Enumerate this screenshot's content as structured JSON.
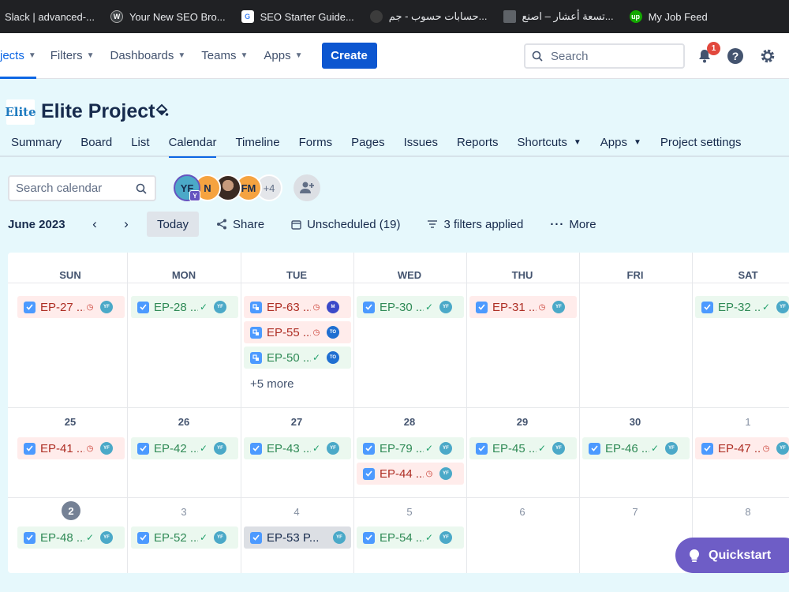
{
  "bookmarks": [
    {
      "label": "Slack | advanced-...",
      "icon": "slack-icon",
      "color": "#202124"
    },
    {
      "label": "Your New SEO Bro...",
      "icon": "wordpress-icon",
      "color": "#21759b"
    },
    {
      "label": "SEO Starter Guide...",
      "icon": "google-icon",
      "color": "#ffffff"
    },
    {
      "label": "حسابات حسوب - جم...",
      "icon": "hsoub-icon",
      "color": "#3c3c3c"
    },
    {
      "label": "تسعة أعشار – اصنع...",
      "icon": "site-icon",
      "color": "#5f6368"
    },
    {
      "label": "My Job Feed",
      "icon": "upwork-icon",
      "color": "#14a800"
    }
  ],
  "topnav": {
    "items": [
      "jects",
      "Filters",
      "Dashboards",
      "Teams",
      "Apps"
    ],
    "create_label": "Create",
    "search_placeholder": "Search",
    "notification_count": "1"
  },
  "project": {
    "logo_text": "Elite",
    "title": "Elite Project",
    "tabs": [
      "Summary",
      "Board",
      "List",
      "Calendar",
      "Timeline",
      "Forms",
      "Pages",
      "Issues",
      "Reports",
      "Shortcuts",
      "Apps",
      "Project settings"
    ],
    "active_tab": "Calendar"
  },
  "toolbar": {
    "search_placeholder": "Search calendar",
    "avatars": [
      {
        "initials": "YF",
        "color": "#4ba9c8",
        "sub": "Y"
      },
      {
        "initials": "N",
        "color": "#f5a340"
      },
      {
        "initials": "",
        "color": "#3b2a22"
      },
      {
        "initials": "FM",
        "color": "#f5a340"
      }
    ],
    "extra_count": "+4",
    "month": "June 2023",
    "today_label": "Today",
    "share_label": "Share",
    "unscheduled_label": "Unscheduled (19)",
    "filters_label": "3 filters applied",
    "more_label": "More"
  },
  "calendar": {
    "days": [
      "SUN",
      "MON",
      "TUE",
      "WED",
      "THU",
      "FRI",
      "SAT"
    ],
    "week2_dates": [
      "25",
      "26",
      "27",
      "28",
      "29",
      "30",
      "1"
    ],
    "week3_dates": [
      "2",
      "3",
      "4",
      "5",
      "6",
      "7",
      "8"
    ],
    "more_label": "+5 more",
    "events_week1": [
      {
        "key": "EP-27 ...",
        "style": "red"
      },
      {
        "key": "EP-28 ...",
        "style": "green"
      },
      {
        "key": "EP-63 ...",
        "style": "red"
      },
      {
        "key": "EP-55 ...",
        "style": "red"
      },
      {
        "key": "EP-50 ...",
        "style": "green"
      },
      {
        "key": "EP-30 ...",
        "style": "green"
      },
      {
        "key": "EP-31 ...",
        "style": "red"
      },
      {
        "key": "EP-32 ...",
        "style": "green"
      }
    ],
    "events_week2": [
      {
        "key": "EP-41 ...",
        "style": "red"
      },
      {
        "key": "EP-42 ...",
        "style": "green"
      },
      {
        "key": "EP-43 ...",
        "style": "green"
      },
      {
        "key": "EP-79 ...",
        "style": "green"
      },
      {
        "key": "EP-44 ...",
        "style": "red"
      },
      {
        "key": "EP-45 ...",
        "style": "green"
      },
      {
        "key": "EP-46 ...",
        "style": "green"
      },
      {
        "key": "EP-47 ...",
        "style": "red"
      }
    ],
    "events_week3": [
      {
        "key": "EP-48 ...",
        "style": "green"
      },
      {
        "key": "EP-52 ...",
        "style": "green"
      },
      {
        "key": "EP-53 P...",
        "style": "gray"
      },
      {
        "key": "EP-54 ...",
        "style": "green"
      }
    ],
    "user_initials": {
      "yf": "YF",
      "m": "M",
      "to": "TO"
    }
  },
  "quickstart_label": "Quickstart"
}
